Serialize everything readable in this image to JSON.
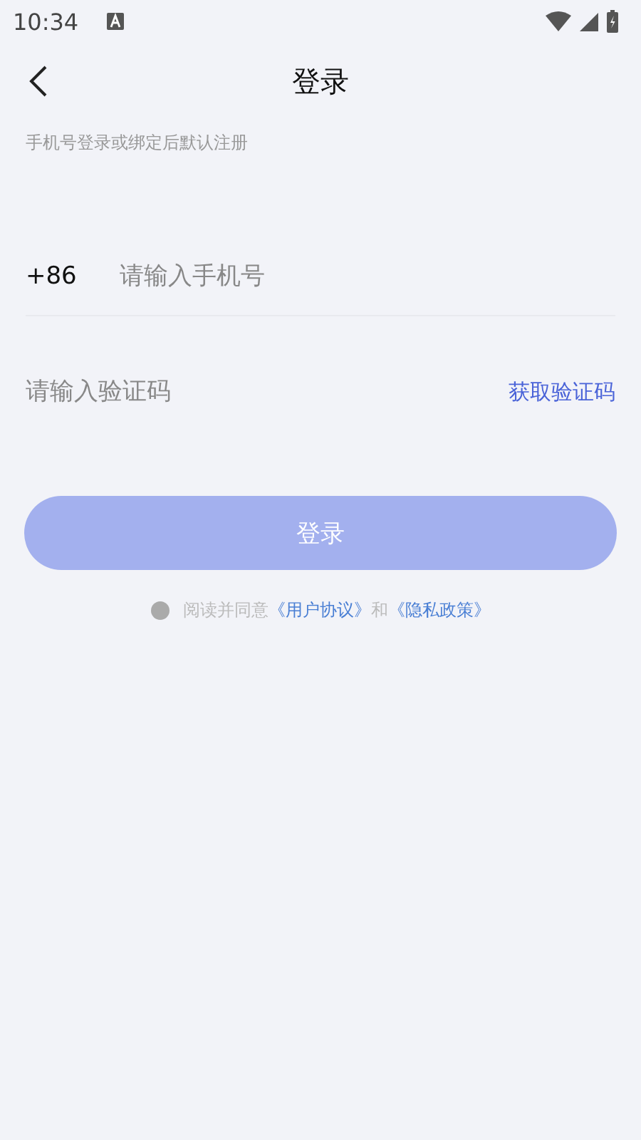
{
  "status_bar": {
    "time": "10:34"
  },
  "header": {
    "title": "登录"
  },
  "hint": "手机号登录或绑定后默认注册",
  "phone": {
    "prefix": "+86",
    "placeholder": "请输入手机号"
  },
  "code": {
    "placeholder": "请输入验证码",
    "action": "获取验证码"
  },
  "login_button": {
    "label": "登录",
    "disabled": true
  },
  "agreement": {
    "checked": false,
    "parts": [
      {
        "kind": "text",
        "text": "阅读并同意"
      },
      {
        "kind": "link",
        "text": "《用户协议》"
      },
      {
        "kind": "text",
        "text": "和"
      },
      {
        "kind": "link",
        "text": "《隐私政策》"
      }
    ]
  }
}
